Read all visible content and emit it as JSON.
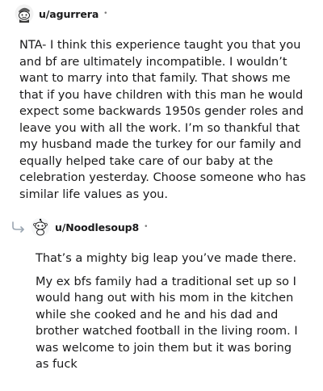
{
  "comment1": {
    "username": "u/agurrera",
    "separator": "•",
    "body": "NTA- I think this experience taught you that you and bf are ultimately incompatible. I wouldn’t want to marry into that family. That shows me that if you have children with this man he would expect some backwards 1950s gender roles and leave you with all the work. I’m so thankful that my husband made the turkey for our family and equally helped take care of our baby at the celebration yesterday. Choose someone who has similar life values as you."
  },
  "comment2": {
    "username": "u/Noodlesoup8",
    "separator": "•",
    "paragraphs": [
      "That’s a mighty big leap you’ve made there.",
      "My ex bfs family had a traditional set up so I would hang out with his mom in the kitchen while she cooked and he and his dad and brother watched football in the living room. I was welcome to join them but it was boring as fuck"
    ]
  },
  "icons": {
    "avatar1": "snoo-avatar-icon",
    "avatar2": "snoo-avatar-icon",
    "reply": "reply-arrow-icon"
  }
}
